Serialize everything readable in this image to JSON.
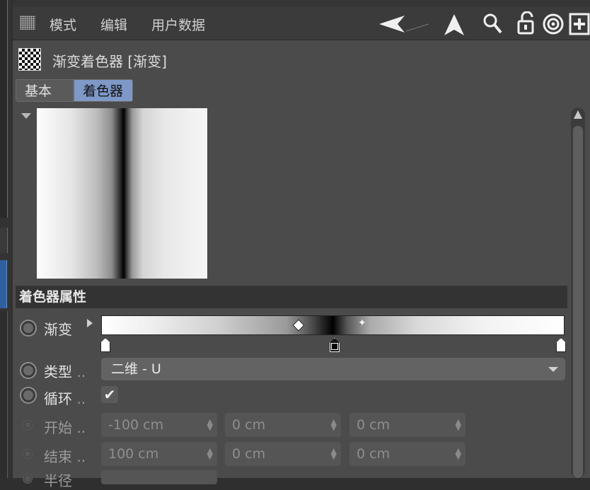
{
  "menu": {
    "items": [
      "模式",
      "编辑",
      "用户数据"
    ]
  },
  "toolbar_icons": [
    "back-arrow-icon",
    "cursor-arrow-icon",
    "search-icon",
    "unlock-icon",
    "target-icon",
    "add-panel-icon"
  ],
  "header": {
    "title": "渐变着色器 [渐变]"
  },
  "tabs": [
    {
      "label": "基本",
      "active": false
    },
    {
      "label": "着色器",
      "active": true
    }
  ],
  "section": {
    "title": "着色器属性"
  },
  "properties": {
    "gradient": {
      "label": "渐变"
    },
    "type": {
      "label": "类型",
      "dots": "..",
      "value": "二维 - U"
    },
    "cycle": {
      "label": "循环",
      "dots": "..",
      "checkmark": "✔"
    },
    "start": {
      "label": "开始",
      "dots": "..",
      "values": [
        "-100 cm",
        "0 cm",
        "0 cm"
      ]
    },
    "end": {
      "label": "结束",
      "dots": "..",
      "values": [
        "100 cm",
        "0 cm",
        "0 cm"
      ]
    },
    "angle": {
      "label": "半径"
    }
  },
  "colors": {
    "panel_bg": "#4b4b4b",
    "active_tab": "#7e98c7",
    "section_bar": "#333333"
  }
}
